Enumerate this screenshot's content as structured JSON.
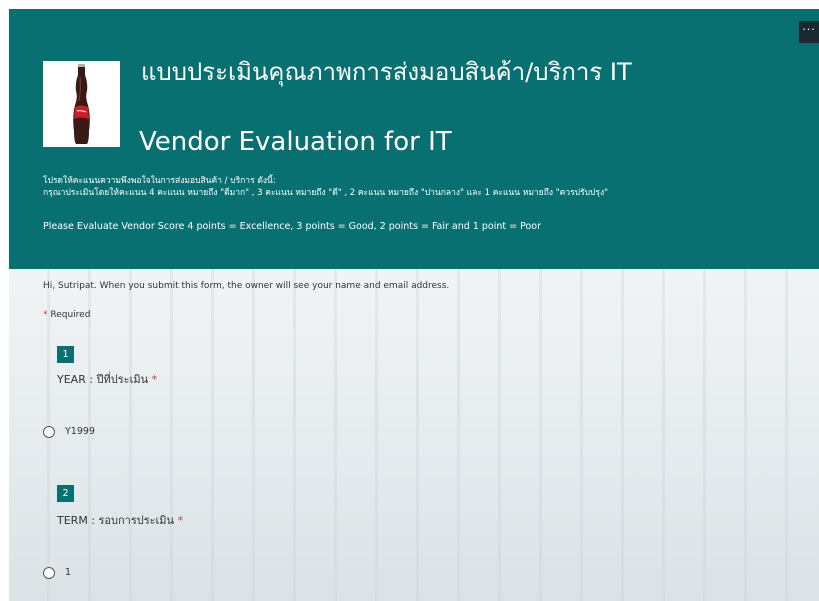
{
  "header": {
    "title_thai": "แบบประเมินคุณภาพการส่งมอบสินค้า/บริการ IT",
    "title_en": "Vendor Evaluation for IT",
    "desc_line1": "โปรดให้คะแนนความพึงพอใจในการส่งมอบสินค้า / บริการ ดังนี้:",
    "desc_line2": "กรุณาประเมินโดยให้คะแนน 4 คะแนน หมายถึง \"ดีมาก\" , 3 คะแนน หมายถึง \"ดี\" , 2 คะแนน หมายถึง \"ปานกลาง\" และ 1 คะแนน หมายถึง \"ควรปรับปรุง\"",
    "desc_en": "Please Evaluate Vendor Score 4 points = Excellence, 3 points = Good, 2 points = Fair and 1 point = Poor",
    "more_label": "···",
    "logo_icon": "coca-cola-bottle-image"
  },
  "form": {
    "notice": "Hi, Sutripat. When you submit this form, the owner will see your name and email address.",
    "required_star": "*",
    "required_label": "Required"
  },
  "questions": [
    {
      "number": "1",
      "title": "YEAR : ปีที่ประเมิน",
      "star": "*",
      "options": [
        "Y1999"
      ]
    },
    {
      "number": "2",
      "title": "TERM : รอบการประเมิน",
      "star": "*",
      "options": [
        "1"
      ]
    }
  ],
  "colors": {
    "header_bg": "#097071",
    "required_star": "#c43e1c"
  }
}
